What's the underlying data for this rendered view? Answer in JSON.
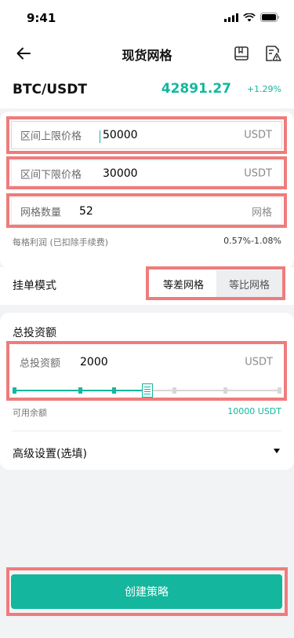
{
  "status_bar": {
    "time": "9:41"
  },
  "nav": {
    "title": "现货网格"
  },
  "pair": {
    "name": "BTC/USDT",
    "price": "42891.27",
    "change": "+1.29%"
  },
  "fields": {
    "upper": {
      "label": "区间上限价格",
      "value": "50000",
      "unit": "USDT"
    },
    "lower": {
      "label": "区间下限价格",
      "value": "30000",
      "unit": "USDT"
    },
    "grid": {
      "label": "网格数量",
      "value": "52",
      "unit": "网格"
    }
  },
  "profit": {
    "label": "每格利润 (已扣除手续费)",
    "value": "0.57%-1.08%"
  },
  "order_mode": {
    "label": "挂单模式",
    "options": [
      "等差网格",
      "等比网格"
    ],
    "selected": "等差网格"
  },
  "investment": {
    "title": "总投资额",
    "label": "总投资额",
    "value": "2000",
    "unit": "USDT",
    "slider_fraction": 0.5
  },
  "available": {
    "label": "可用余额",
    "value": "10000 USDT"
  },
  "advanced": {
    "label": "高级设置(选填)"
  },
  "create_button": {
    "label": "创建策略"
  },
  "colors": {
    "accent": "#14b79e",
    "highlight": "#ef7c7c"
  }
}
